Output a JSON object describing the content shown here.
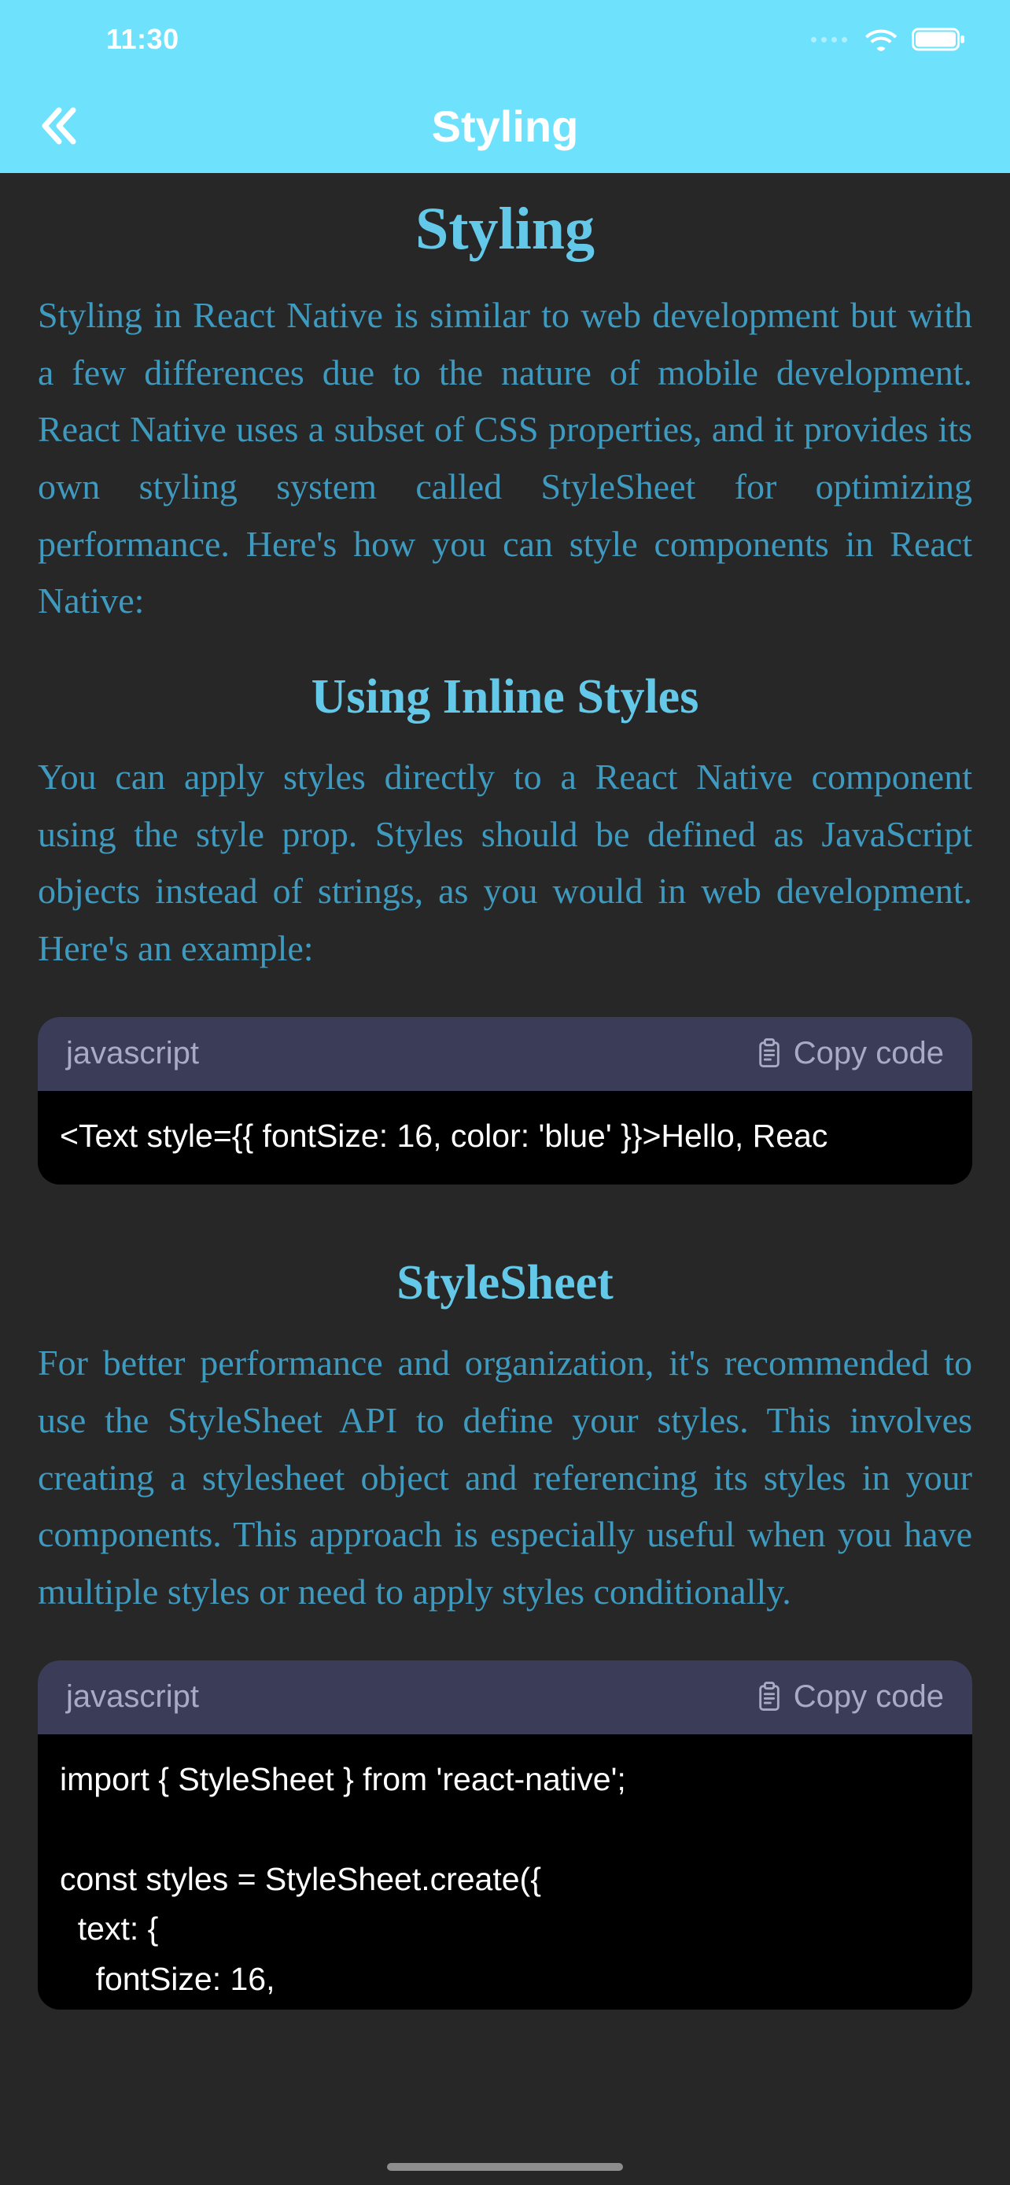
{
  "status": {
    "time": "11:30"
  },
  "nav": {
    "title": "Styling"
  },
  "article": {
    "title": "Styling",
    "intro": "Styling in React Native is similar to web development but with a few differences due to the nature of mobile development. React Native uses a subset of CSS properties, and it provides its own styling system called StyleSheet for optimizing performance. Here's how you can style components in React Native:",
    "sections": [
      {
        "heading": "Using Inline Styles",
        "body": "You can apply styles directly to a React Native component using the style prop. Styles should be defined as JavaScript objects instead of strings, as you would in web development. Here's an example:",
        "code_lang": "javascript",
        "copy_label": "Copy code",
        "code": "<Text style={{ fontSize: 16, color: 'blue' }}>Hello, Reac"
      },
      {
        "heading": "StyleSheet",
        "body": "For better performance and organization, it's recommended to use the StyleSheet API to define your styles. This involves creating a stylesheet object and referencing its styles in your components. This approach is especially useful when you have multiple styles or need to apply styles conditionally.",
        "code_lang": "javascript",
        "copy_label": "Copy code",
        "code": "import { StyleSheet } from 'react-native';\n\nconst styles = StyleSheet.create({\n  text: {\n    fontSize: 16,"
      }
    ]
  }
}
